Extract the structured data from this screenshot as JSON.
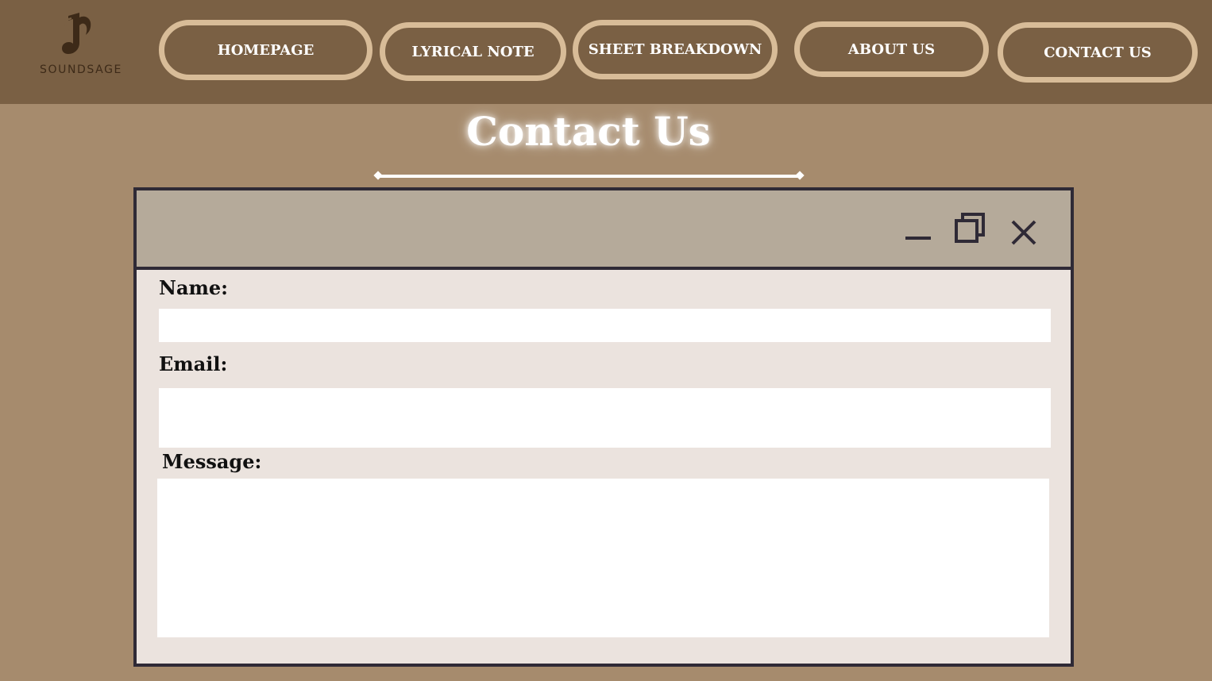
{
  "brand": {
    "name": "SOUNDSAGE",
    "logo_icon": "music-note-icon",
    "logo_color": "#3d2a18"
  },
  "nav": {
    "items": [
      {
        "label": "HOMEPAGE"
      },
      {
        "label": "LYRICAL NOTE"
      },
      {
        "label": "SHEET BREAKDOWN"
      },
      {
        "label": "ABOUT US"
      },
      {
        "label": "CONTACT US"
      }
    ]
  },
  "page": {
    "title": "Contact Us"
  },
  "window": {
    "controls": [
      "minimize-icon",
      "restore-icon",
      "close-icon"
    ]
  },
  "form": {
    "name_label": "Name:",
    "name_value": "",
    "email_label": "Email:",
    "email_value": "",
    "message_label": "Message:",
    "message_value": ""
  },
  "colors": {
    "header_bg": "#7a6044",
    "page_bg": "#a68b6d",
    "button_border": "#d8bc98",
    "window_titlebar": "#b5aa9a",
    "window_body": "#ebe3de",
    "window_border": "#2f2a36"
  }
}
